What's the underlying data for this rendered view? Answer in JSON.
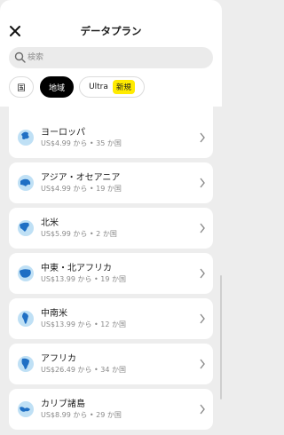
{
  "header": {
    "title": "データプラン"
  },
  "search": {
    "placeholder": "検索"
  },
  "filters": {
    "country": "国",
    "region": "地域",
    "ultra": "Ultra",
    "ultra_badge": "新規"
  },
  "plans": [
    {
      "name": "ヨーロッパ",
      "price": "US$4.99 から • 35 か国"
    },
    {
      "name": "アジア・オセアニア",
      "price": "US$4.99 から • 19 か国"
    },
    {
      "name": "北米",
      "price": "US$5.99 から • 2 か国"
    },
    {
      "name": "中東・北アフリカ",
      "price": "US$13.99 から • 19 か国"
    },
    {
      "name": "中南米",
      "price": "US$13.99 から • 12 か国"
    },
    {
      "name": "アフリカ",
      "price": "US$26.49 から • 34 か国"
    },
    {
      "name": "カリブ諸島",
      "price": "US$8.99 から • 29 か国"
    }
  ],
  "colors": {
    "accent": "#ffeb00",
    "globe_light": "#bfe0f5",
    "globe_dark": "#1f6fc4"
  }
}
